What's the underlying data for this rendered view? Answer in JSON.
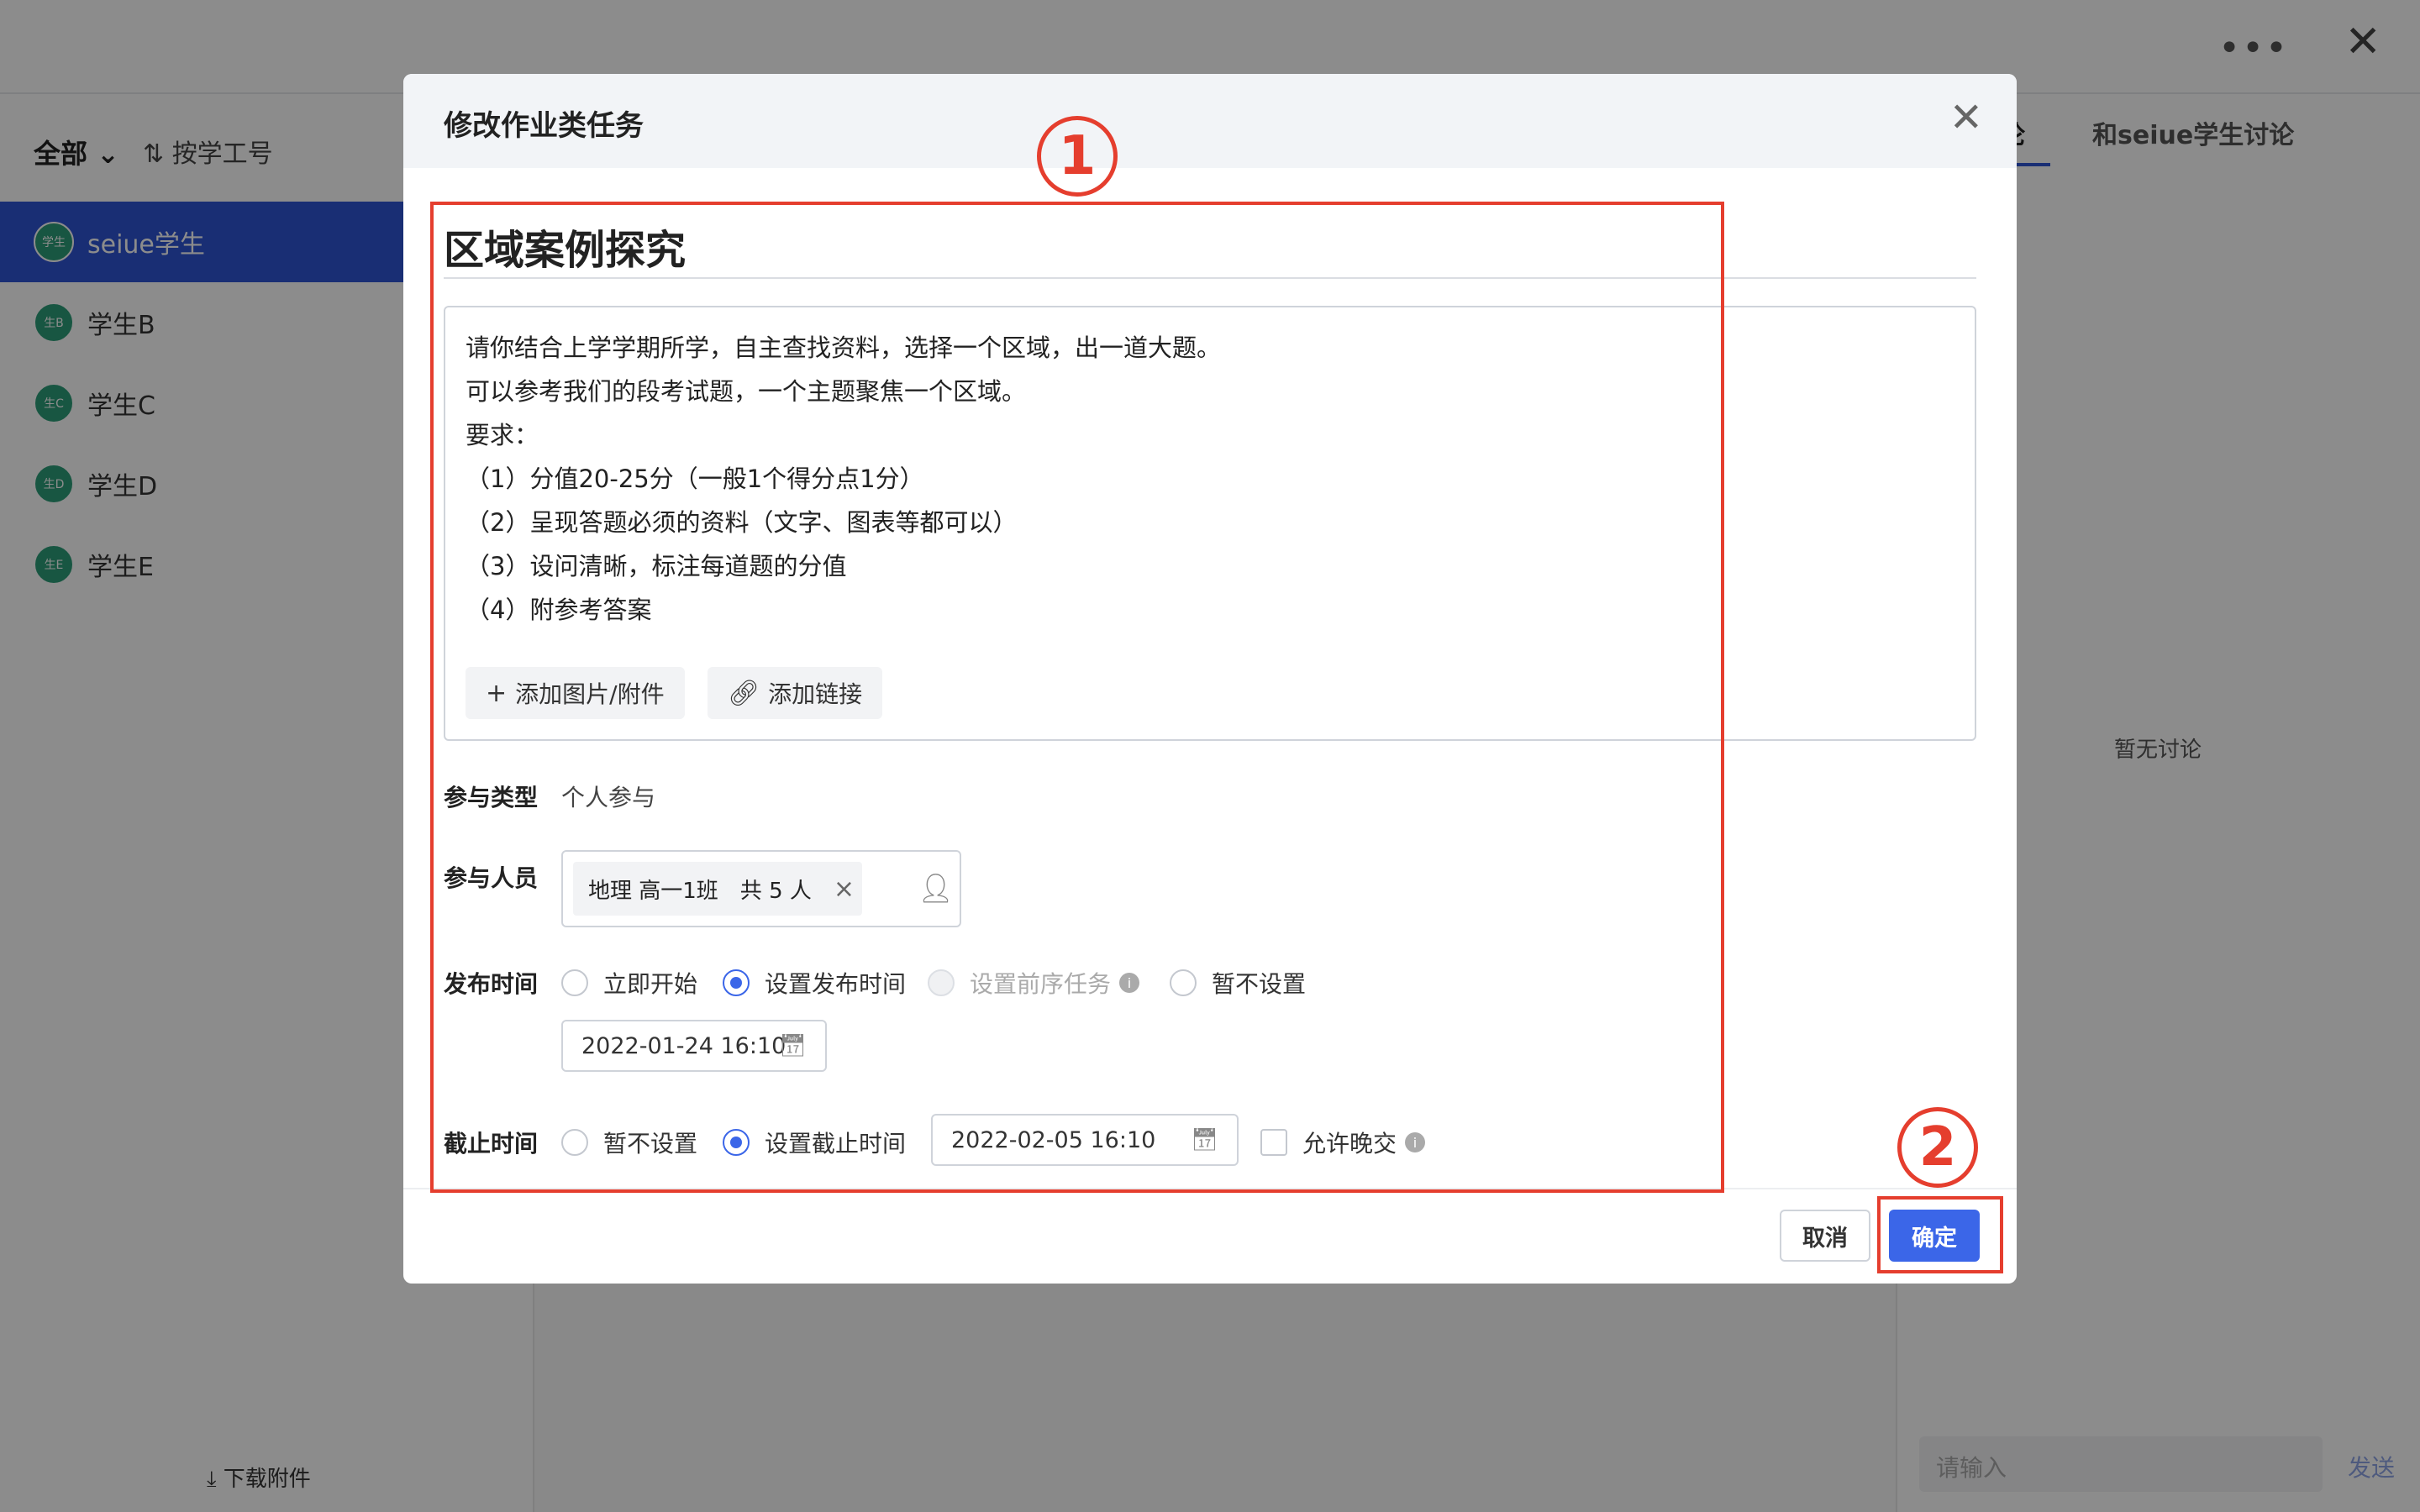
{
  "background": {
    "more_icon": "•••",
    "close_icon": "✕",
    "filter_all": "全部",
    "filter_sort": "按学工号",
    "students": [
      {
        "avatar": "学生",
        "name": "seiue学生",
        "active": true
      },
      {
        "avatar": "生B",
        "name": "学生B",
        "active": false
      },
      {
        "avatar": "生C",
        "name": "学生C",
        "active": false
      },
      {
        "avatar": "生D",
        "name": "学生D",
        "active": false
      },
      {
        "avatar": "生E",
        "name": "学生E",
        "active": false
      }
    ],
    "download": "下载附件",
    "tab_a": "论",
    "tab_b": "和seiue学生讨论",
    "no_discussion": "暂无讨论",
    "chat_placeholder": "请输入",
    "send": "发送"
  },
  "modal": {
    "title": "修改作业类任务",
    "close_icon": "✕",
    "task_title": "区域案例探究",
    "description": [
      "请你结合上学学期所学，自主查找资料，选择一个区域，出一道大题。",
      "可以参考我们的段考试题，一个主题聚焦一个区域。",
      "要求：",
      "（1）分值20-25分（一般1个得分点1分）",
      "（2）呈现答题必须的资料（文字、图表等都可以）",
      "（3）设问清晰，标注每道题的分值",
      "（4）附参考答案"
    ],
    "add_attachment": "添加图片/附件",
    "add_link": "添加链接",
    "participation_type_label": "参与类型",
    "participation_type_value": "个人参与",
    "participants_label": "参与人员",
    "participant_tag": "地理 高一1班　共 5 人",
    "publish_label": "发布时间",
    "publish_options": [
      "立即开始",
      "设置发布时间",
      "设置前序任务",
      "暂不设置"
    ],
    "publish_date": "2022-01-24 16:10",
    "deadline_label": "截止时间",
    "deadline_options": [
      "暂不设置",
      "设置截止时间"
    ],
    "deadline_date": "2022-02-05 16:10",
    "allow_late": "允许晚交",
    "cancel": "取消",
    "confirm": "确定"
  },
  "annotations": {
    "marker_1": "1",
    "marker_2": "2",
    "color": "#e53e2e"
  },
  "colors": {
    "accent": "#3b66e8",
    "sidebar_active": "#2f55d4",
    "avatar": "#2d9d78"
  }
}
